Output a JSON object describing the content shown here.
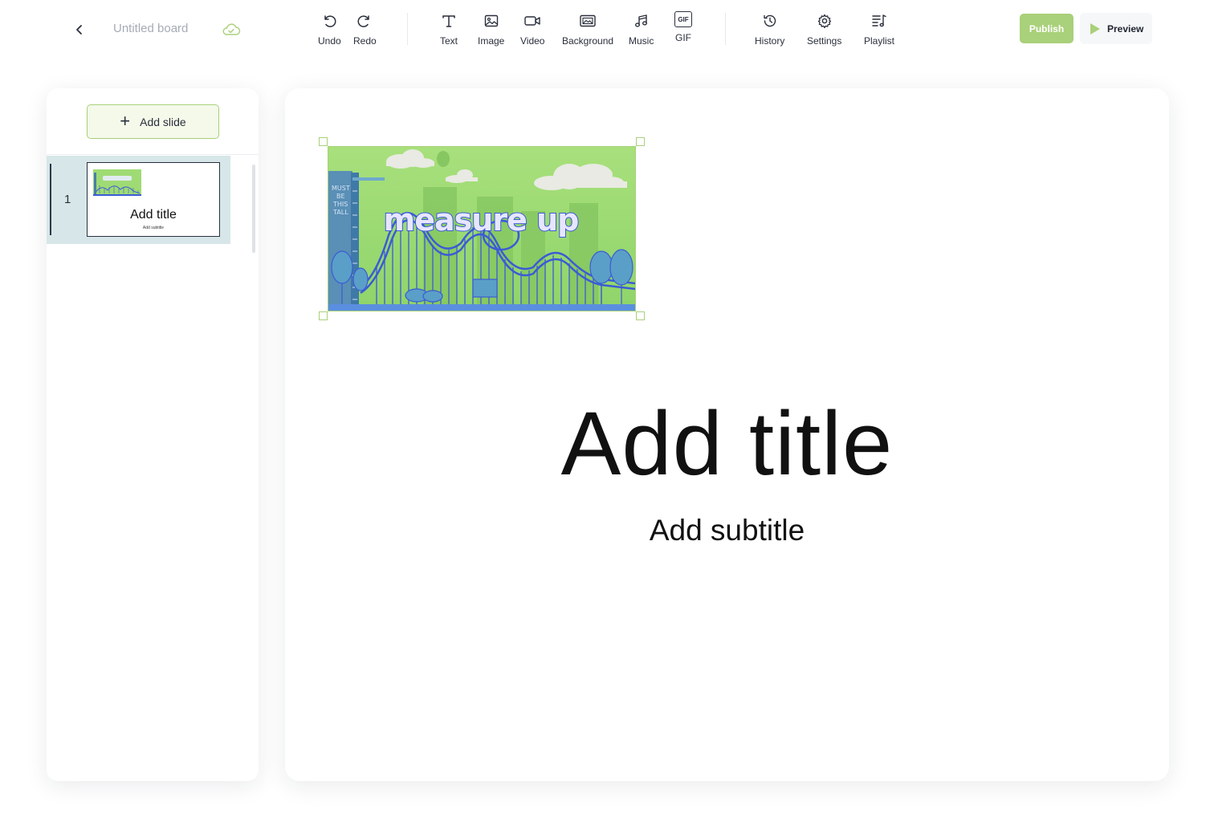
{
  "header": {
    "back_icon": "chevron-left-icon",
    "board_title": "Untitled board",
    "save_status_icon": "cloud-check-icon",
    "tools": [
      {
        "label": "Undo",
        "icon": "undo-icon"
      },
      {
        "label": "Redo",
        "icon": "redo-icon"
      },
      {
        "label": "Text",
        "icon": "text-icon"
      },
      {
        "label": "Image",
        "icon": "image-icon"
      },
      {
        "label": "Video",
        "icon": "video-icon"
      },
      {
        "label": "Background",
        "icon": "background-icon"
      },
      {
        "label": "Music",
        "icon": "music-icon"
      },
      {
        "label": "GIF",
        "icon": "gif-icon"
      },
      {
        "label": "History",
        "icon": "history-icon"
      },
      {
        "label": "Settings",
        "icon": "gear-icon"
      },
      {
        "label": "Playlist",
        "icon": "playlist-icon"
      }
    ],
    "gif_badge": "GIF",
    "publish_label": "Publish",
    "preview_label": "Preview"
  },
  "sidebar": {
    "add_slide_label": "Add slide",
    "slides": [
      {
        "number": "1",
        "title": "Add title",
        "subtitle": "Add subtitle"
      }
    ]
  },
  "canvas": {
    "image_text": "measure up",
    "image_sign": [
      "MUST",
      "BE",
      "THIS",
      "TALL"
    ],
    "title": "Add title",
    "subtitle": "Add subtitle"
  },
  "colors": {
    "accent": "#a9d07a",
    "image_green": "#9fdb74",
    "image_blue": "#3b5bd6",
    "active_slide_bg": "#d7e6e8"
  }
}
